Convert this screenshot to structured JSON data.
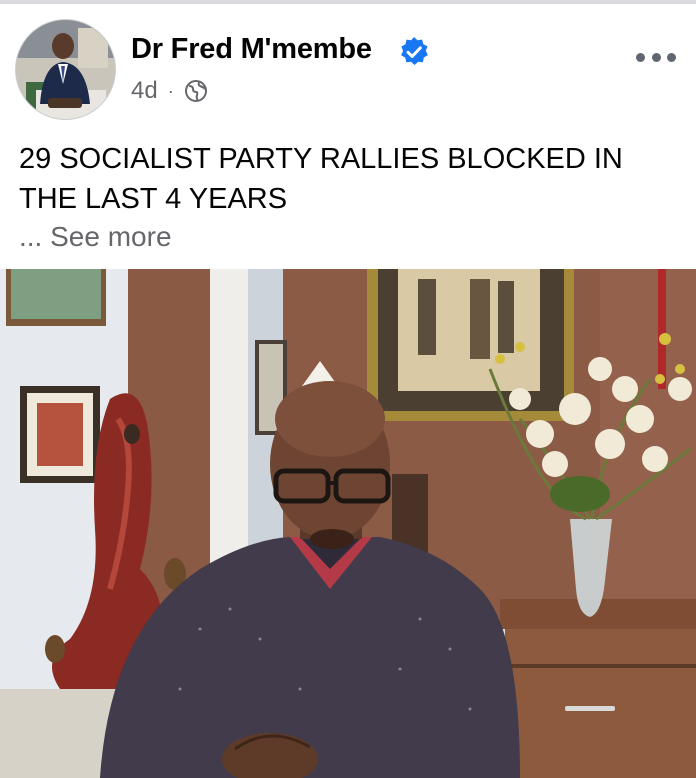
{
  "post": {
    "author": "Dr Fred M'membe",
    "time": "4d",
    "separator": "·",
    "text": "29 SOCIALIST PARTY RALLIES BLOCKED IN THE LAST 4 YEARS",
    "see_more": "... See more"
  },
  "icons": {
    "verified": "verified-badge-icon",
    "audience": "globe-icon",
    "menu": "more-options-icon"
  },
  "colors": {
    "verified_blue": "#1877f2",
    "secondary_text": "#65676b",
    "primary_text": "#050505"
  }
}
